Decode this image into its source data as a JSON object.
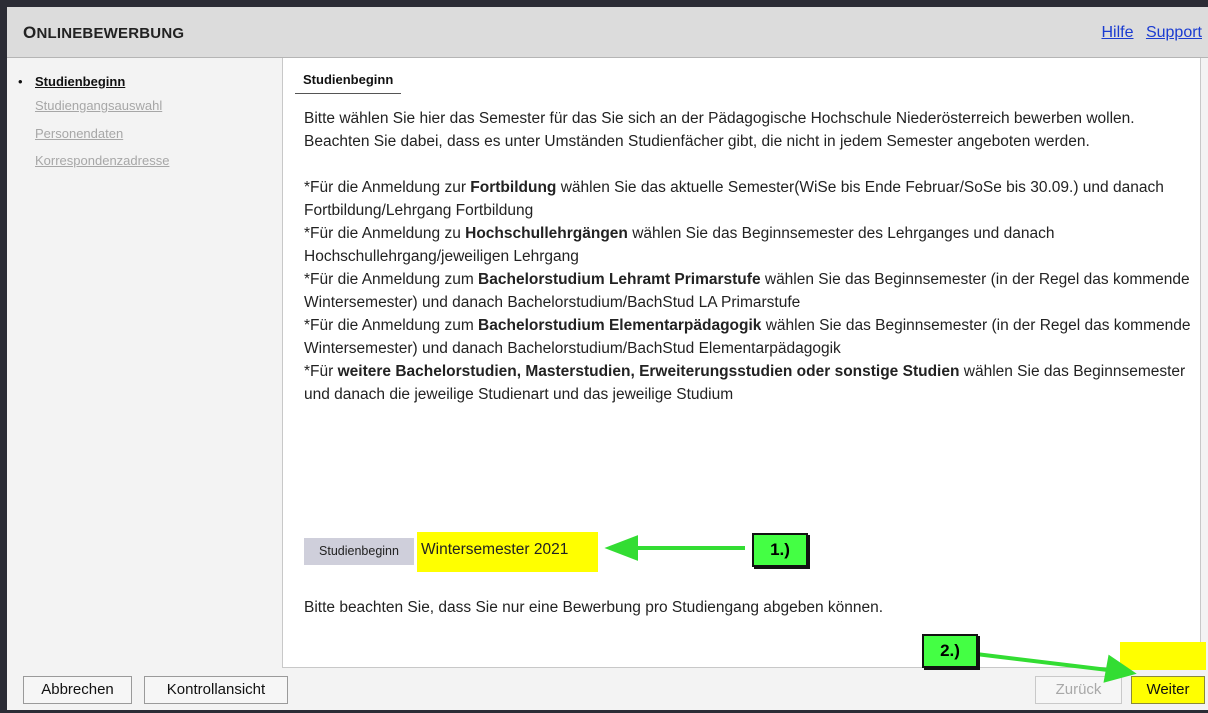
{
  "header": {
    "title_first": "O",
    "title_rest": "NLINEBEWERBUNG",
    "links": [
      "Hilfe",
      "Support"
    ]
  },
  "sidebar": {
    "bullet": "•",
    "items": [
      {
        "label": "Studienbeginn",
        "active": true
      },
      {
        "label": "Studiengangsauswahl",
        "active": false
      },
      {
        "label": "Personendaten",
        "active": false
      },
      {
        "label": "Korrespondenzadresse",
        "active": false
      }
    ]
  },
  "main": {
    "section_title": "Studienbeginn",
    "intro_1": "Bitte wählen Sie hier das Semester für das Sie sich an der Pädagogische Hochschule Niederösterreich bewerben wollen.",
    "intro_2": "Beachten Sie dabei, dass es unter Umständen Studienfächer gibt, die nicht in jedem Semester angeboten werden.",
    "instructions": [
      {
        "pre": "*Für die Anmeldung zur ",
        "bold": "Fortbildung",
        "post": " wählen Sie das aktuelle Semester(WiSe bis Ende Februar/SoSe bis 30.09.) und danach Fortbildung/Lehrgang Fortbildung"
      },
      {
        "pre": "*Für die Anmeldung zu ",
        "bold": "Hochschullehrgängen",
        "post": " wählen Sie das Beginnsemester des Lehrganges und danach Hochschullehrgang/jeweiligen Lehrgang"
      },
      {
        "pre": "*Für die Anmeldung zum ",
        "bold": "Bachelorstudium Lehramt Primarstufe",
        "post": " wählen Sie das Beginnsemester (in der Regel das kommende Wintersemester) und danach Bachelorstudium/BachStud LA Primarstufe"
      },
      {
        "pre": "*Für die Anmeldung zum ",
        "bold": "Bachelorstudium Elementarpädagogik",
        "post": " wählen Sie das Beginnsemester (in der Regel das kommende Wintersemester) und danach Bachelorstudium/BachStud Elementarpädagogik"
      },
      {
        "pre": "*Für ",
        "bold": "weitere Bachelorstudien, Masterstudien, Erweiterungsstudien oder sonstige Studien",
        "post": " wählen Sie das Beginnsemester und danach die jeweilige Studienart und das jeweilige Studium"
      }
    ],
    "field_label": "Studienbeginn",
    "field_value": "Wintersemester 2021",
    "note": "Bitte beachten Sie, dass Sie nur eine Bewerbung pro Studiengang abgeben können."
  },
  "footer": {
    "abbrechen": "Abbrechen",
    "kontrollansicht": "Kontrollansicht",
    "zurueck": "Zurück",
    "weiter": "Weiter"
  },
  "annotations": {
    "step1": "1.)",
    "step2": "2.)",
    "highlight_color": "#ffff00",
    "callout_color": "#44ff44"
  }
}
